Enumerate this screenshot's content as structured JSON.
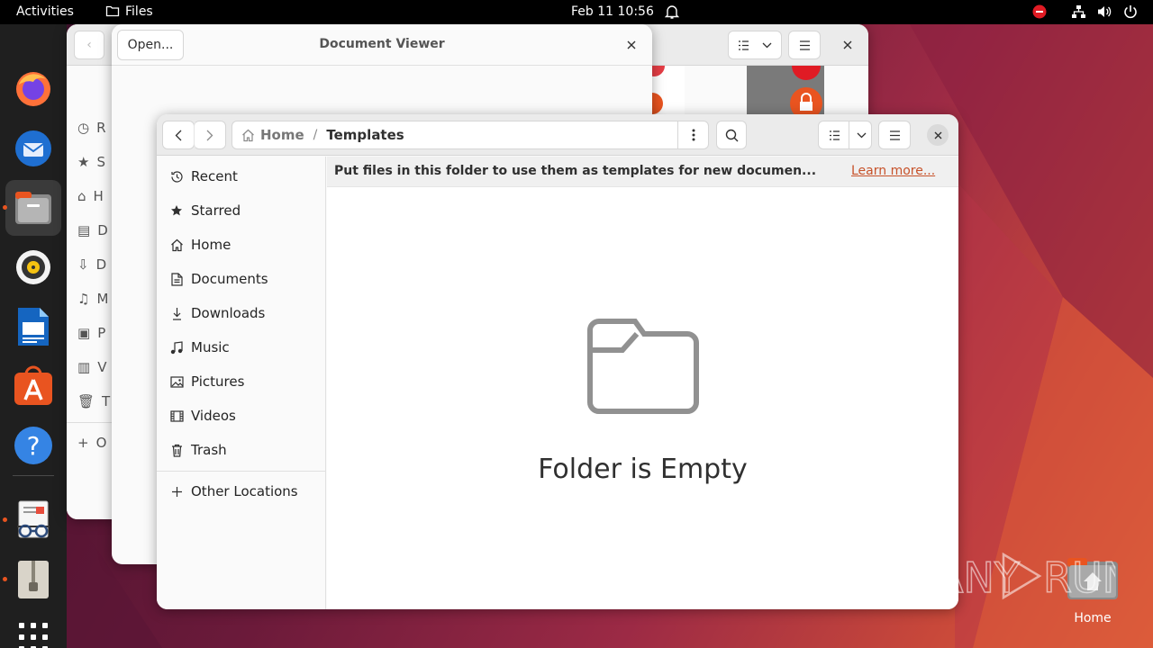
{
  "topbar": {
    "activities": "Activities",
    "app_name": "Files",
    "clock": "Feb 11  10:56"
  },
  "dock": {
    "apps": [
      "firefox-icon",
      "thunderbird-icon",
      "files-icon",
      "rhythmbox-icon",
      "writer-icon",
      "app-center-icon",
      "help-icon",
      "document-viewer-icon",
      "archive-manager-icon",
      "show-apps-icon"
    ]
  },
  "bg_files_window": {
    "sidebar_letters": [
      "R",
      "S",
      "H",
      "D",
      "D",
      "M",
      "P",
      "V",
      "T",
      "O"
    ]
  },
  "document_viewer": {
    "open_label": "Open...",
    "title": "Document Viewer"
  },
  "files": {
    "path": {
      "home": "Home",
      "separator": "/",
      "current": "Templates"
    },
    "sidebar": {
      "items": [
        {
          "label": "Recent",
          "icon": "recent-icon"
        },
        {
          "label": "Starred",
          "icon": "star-icon"
        },
        {
          "label": "Home",
          "icon": "home-icon"
        },
        {
          "label": "Documents",
          "icon": "documents-icon"
        },
        {
          "label": "Downloads",
          "icon": "downloads-icon"
        },
        {
          "label": "Music",
          "icon": "music-icon"
        },
        {
          "label": "Pictures",
          "icon": "pictures-icon"
        },
        {
          "label": "Videos",
          "icon": "videos-icon"
        },
        {
          "label": "Trash",
          "icon": "trash-icon"
        }
      ],
      "other_locations": "Other Locations"
    },
    "info_bar": {
      "message": "Put files in this folder to use them as templates for new documen...",
      "link": "Learn more..."
    },
    "empty_state": "Folder is Empty"
  },
  "desktop": {
    "home_label": "Home"
  },
  "watermark": "ANY RUN",
  "colors": {
    "accent": "#e95420",
    "link": "#c7522a"
  }
}
